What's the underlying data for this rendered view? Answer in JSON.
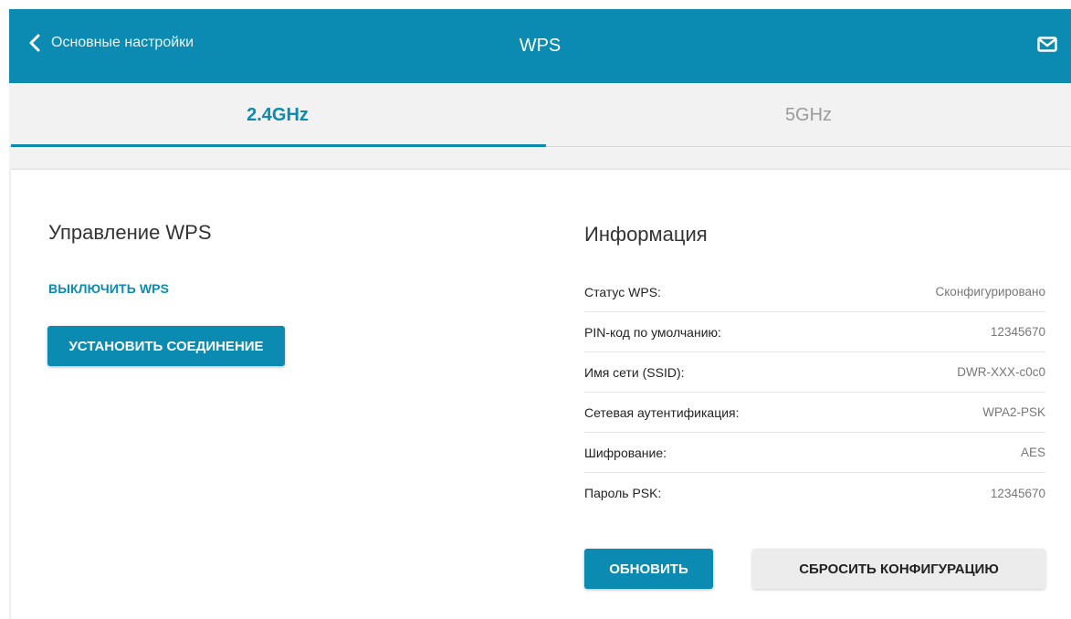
{
  "header": {
    "back_label": "Основные настройки",
    "title": "WPS",
    "icons": {
      "back": "chevron-left-icon",
      "mail": "mail-icon"
    }
  },
  "tabs": [
    {
      "label": "2.4GHz",
      "active": true
    },
    {
      "label": "5GHz",
      "active": false
    }
  ],
  "wps_control": {
    "title": "Управление WPS",
    "disable_label": "ВЫКЛЮЧИТЬ WPS",
    "connect_label": "УСТАНОВИТЬ СОЕДИНЕНИЕ"
  },
  "info": {
    "title": "Информация",
    "rows": [
      {
        "label": "Статус WPS:",
        "value": "Сконфигурировано"
      },
      {
        "label": "PIN-код по умолчанию:",
        "value": "12345670"
      },
      {
        "label": "Имя сети (SSID):",
        "value": "DWR-XXX-c0c0"
      },
      {
        "label": "Сетевая аутентификация:",
        "value": "WPA2-PSK"
      },
      {
        "label": "Шифрование:",
        "value": "AES"
      },
      {
        "label": "Пароль PSK:",
        "value": "12345670"
      }
    ],
    "refresh_label": "ОБНОВИТЬ",
    "reset_label": "СБРОСИТЬ КОНФИГУРАЦИЮ"
  },
  "colors": {
    "accent": "#0b8bb1",
    "background": "#f2f2f2",
    "card": "#ffffff"
  }
}
